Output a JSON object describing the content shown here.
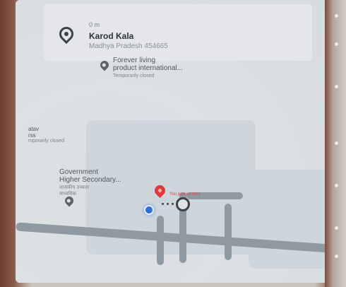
{
  "place_card": {
    "distance": "0 m",
    "title": "Karod Kala",
    "address": "Madhya Pradesh 454665"
  },
  "pois": [
    {
      "name": "Forever living\nproduct international...",
      "status": "Temporarily closed"
    },
    {
      "name": "atav\nrss",
      "status": "mporarily closed"
    },
    {
      "name": "Government\nHigher Secondary...",
      "status": "शासकीय उच्चतर\nमाध्यमिक"
    }
  ],
  "marker": {
    "label": "You parked here"
  },
  "colors": {
    "pin": "#e2393f",
    "location_dot": "#2f6fd8",
    "road": "#8e99a2"
  }
}
